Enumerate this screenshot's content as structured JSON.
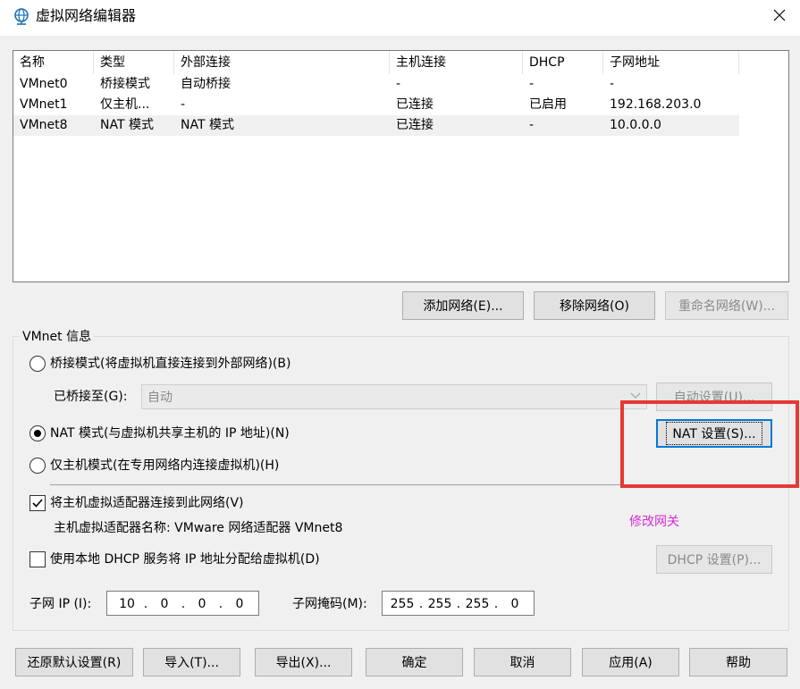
{
  "window": {
    "title": "虚拟网络编辑器",
    "icon": "globe-network-icon"
  },
  "table": {
    "headers": [
      "名称",
      "类型",
      "外部连接",
      "主机连接",
      "DHCP",
      "子网地址"
    ],
    "rows": [
      [
        "VMnet0",
        "桥接模式",
        "自动桥接",
        "-",
        "-",
        "-"
      ],
      [
        "VMnet1",
        "仅主机...",
        "-",
        "已连接",
        "已启用",
        "192.168.203.0"
      ],
      [
        "VMnet8",
        "NAT 模式",
        "NAT 模式",
        "已连接",
        "-",
        "10.0.0.0"
      ]
    ],
    "selected_row": 2
  },
  "net_buttons": {
    "add": "添加网络(E)...",
    "remove": "移除网络(O)",
    "rename": "重命名网络(W)..."
  },
  "vmnet_info": {
    "group_title": "VMnet 信息",
    "bridge_radio": "桥接模式(将虚拟机直接连接到外部网络)(B)",
    "bridged_to_label": "已桥接至(G):",
    "bridged_to_value": "自动",
    "auto_settings": "自动设置(U)...",
    "nat_radio": "NAT 模式(与虚拟机共享主机的 IP 地址)(N)",
    "nat_settings": "NAT 设置(S)...",
    "hostonly_radio": "仅主机模式(在专用网络内连接虚拟机)(H)",
    "selected_mode": "nat",
    "connect_adapter_check": "将主机虚拟适配器连接到此网络(V)",
    "connect_adapter_checked": true,
    "adapter_name_label": "主机虚拟适配器名称: VMware 网络适配器 VMnet8",
    "dhcp_check": "使用本地 DHCP 服务将 IP 地址分配给虚拟机(D)",
    "dhcp_checked": false,
    "dhcp_settings": "DHCP 设置(P)...",
    "subnet_ip_label": "子网 IP (I):",
    "subnet_ip": [
      "10",
      "0",
      "0",
      "0"
    ],
    "subnet_mask_label": "子网掩码(M):",
    "subnet_mask": [
      "255",
      "255",
      "255",
      "0"
    ]
  },
  "annotation": {
    "text": "修改网关",
    "color": "#d62ad6",
    "box_color": "#e53935"
  },
  "footer_buttons": {
    "restore": "还原默认设置(R)",
    "import": "导入(T)...",
    "export": "导出(X)...",
    "ok": "确定",
    "cancel": "取消",
    "apply": "应用(A)",
    "help": "帮助"
  }
}
